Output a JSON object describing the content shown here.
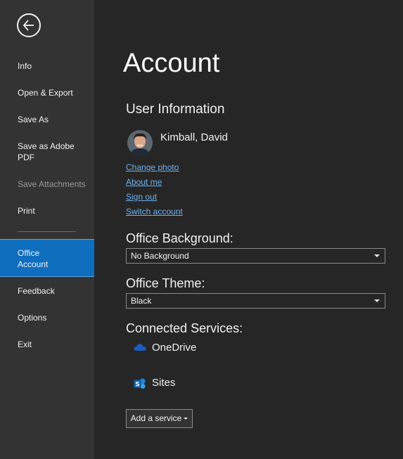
{
  "sidebar": {
    "back_icon": "back-arrow-icon",
    "items": [
      {
        "label": "Info"
      },
      {
        "label": "Open & Export"
      },
      {
        "label": "Save As"
      },
      {
        "label": "Save as Adobe PDF"
      },
      {
        "label": "Save Attachments"
      },
      {
        "label": "Print"
      },
      {
        "label": "Office Account"
      },
      {
        "label": "Feedback"
      },
      {
        "label": "Options"
      },
      {
        "label": "Exit"
      }
    ],
    "selected_color": "#106ebe"
  },
  "main": {
    "title": "Account",
    "user_info": {
      "heading": "User Information",
      "name": "Kimball, David",
      "links": {
        "change_photo": "Change photo",
        "about_me": "About me",
        "sign_out": "Sign out",
        "switch_account": "Switch account"
      }
    },
    "background": {
      "heading": "Office Background:",
      "value": "No Background"
    },
    "theme": {
      "heading": "Office Theme:",
      "value": "Black"
    },
    "connected_services": {
      "heading": "Connected Services:",
      "services": [
        {
          "label": "OneDrive",
          "icon": "onedrive-cloud-icon"
        },
        {
          "label": "Sites",
          "icon": "sharepoint-sites-icon"
        }
      ],
      "add_button": "Add a service"
    }
  },
  "colors": {
    "sidebar_bg": "#333333",
    "main_bg": "#262626",
    "link": "#6eb1f0"
  }
}
